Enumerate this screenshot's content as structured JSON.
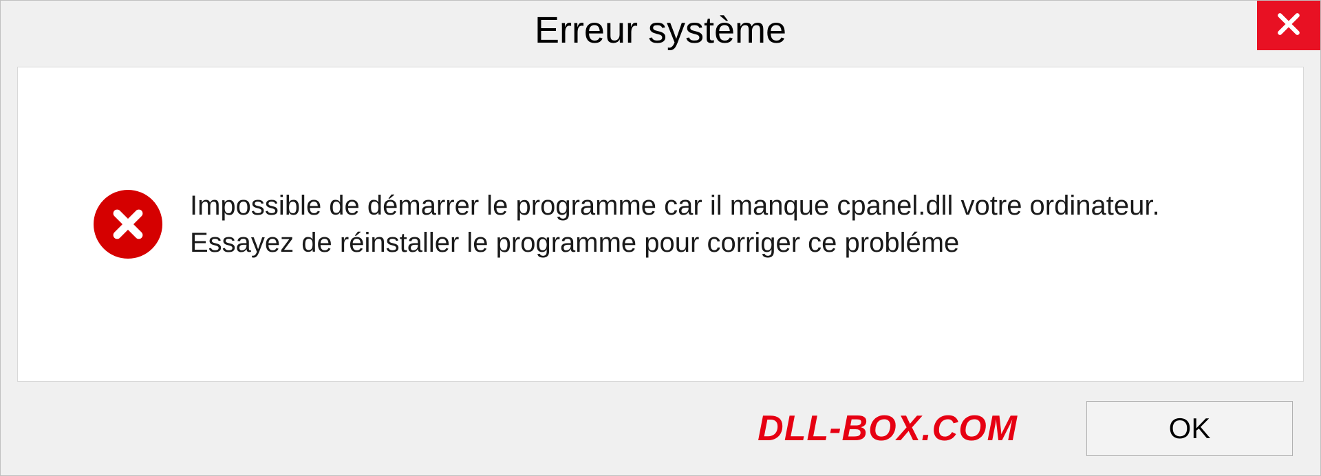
{
  "dialog": {
    "title": "Erreur système",
    "message": "Impossible de démarrer le programme car il manque cpanel.dll votre ordinateur. Essayez de réinstaller le programme pour corriger ce probléme",
    "ok_label": "OK",
    "brand": "DLL-BOX.COM"
  }
}
